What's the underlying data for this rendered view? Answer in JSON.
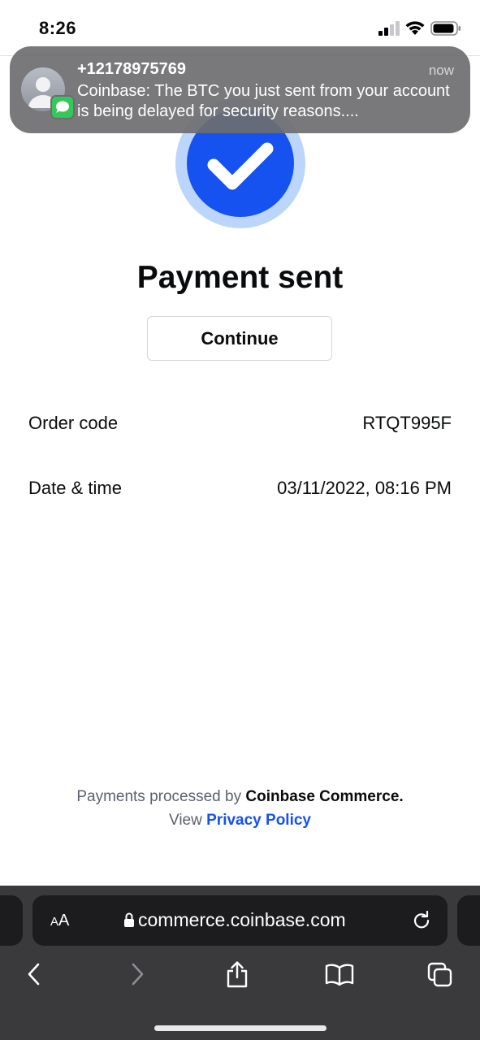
{
  "status_bar": {
    "time": "8:26"
  },
  "notification": {
    "sender": "+12178975769",
    "time": "now",
    "body": "Coinbase: The BTC you just sent from your account is being delayed for security reasons...."
  },
  "payment": {
    "title": "Payment sent",
    "continue_label": "Continue",
    "rows": [
      {
        "label": "Order code",
        "value": "RTQT995F"
      },
      {
        "label": "Date & time",
        "value": "03/11/2022, 08:16 PM"
      }
    ]
  },
  "footer": {
    "processed_prefix": "Payments processed by",
    "processor": "Coinbase Commerce.",
    "view_prefix": "View",
    "privacy_link": "Privacy Policy"
  },
  "browser": {
    "text_size_label_big": "A",
    "text_size_label_small": "A",
    "url": "commerce.coinbase.com"
  },
  "colors": {
    "accent": "#1652f0",
    "accent_ring": "#bcd6fb",
    "toolbar": "#3a3a3c",
    "notification": "#6e6e70"
  }
}
